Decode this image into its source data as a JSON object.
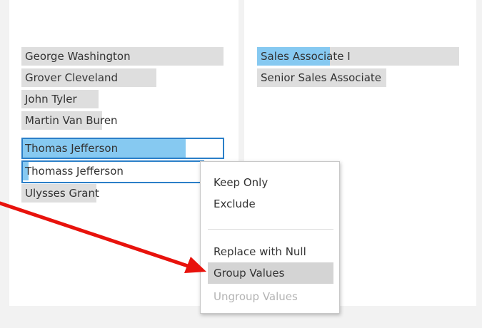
{
  "names_list": {
    "items": [
      {
        "label": "George Washington",
        "bar_fraction": 1.0
      },
      {
        "label": "Grover Cleveland",
        "bar_fraction": 0.67
      },
      {
        "label": "John Tyler",
        "bar_fraction": 0.38
      },
      {
        "label": "Martin Van Buren",
        "bar_fraction": 0.4
      },
      {
        "label": "Thomas Jefferson",
        "bar_fraction": 0.81,
        "selected": true
      },
      {
        "label": "Thomass Jefferson",
        "bar_fraction": 0.03,
        "selected": true
      },
      {
        "label": "Ulysses Grant",
        "bar_fraction": 0.37
      }
    ]
  },
  "titles_list": {
    "items": [
      {
        "label": "Sales Associate I",
        "bar_fraction": 1.0,
        "highlight_fraction": 0.36
      },
      {
        "label": "Senior Sales Associate",
        "bar_fraction": 0.64
      }
    ]
  },
  "context_menu": {
    "keep_only": "Keep Only",
    "exclude": "Exclude",
    "replace_with_null": "Replace with Null",
    "group_values": "Group Values",
    "ungroup_values": "Ungroup Values"
  },
  "colors": {
    "bar": "#dedede",
    "selected_bar": "#86c9f1",
    "selection_border": "#2b7fc8",
    "menu_hover": "#d4d4d4",
    "arrow": "#e8120c"
  }
}
